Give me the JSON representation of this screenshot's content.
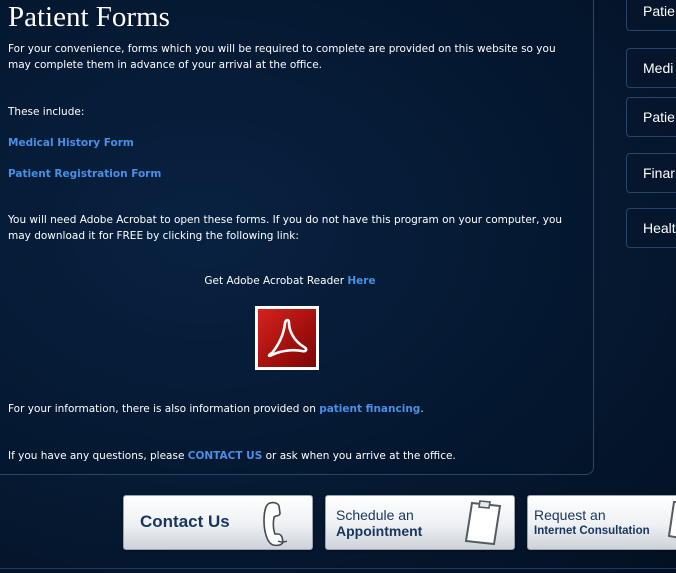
{
  "page": {
    "title": "Patient Forms"
  },
  "content": {
    "intro": "For your convenience, forms which you will be required to complete are provided on this website so you may complete them in advance of your arrival at the office.",
    "includes_label": "These include:",
    "forms": [
      {
        "label": "Medical History Form"
      },
      {
        "label": "Patient Registration Form"
      }
    ],
    "acrobat_note": "You will need Adobe Acrobat to open these forms.  If you do not have this program on your computer, you may download it for FREE by clicking the following link:",
    "acrobat_line": {
      "prefix": "Get Adobe Acrobat Reader ",
      "link": "Here"
    },
    "financing": {
      "prefix": "For your information, there is also information provided on ",
      "link": "patient financing",
      "suffix": "."
    },
    "contact": {
      "prefix": "If you have any questions, please ",
      "link": "CONTACT US",
      "suffix": " or ask when you arrive at the office."
    }
  },
  "sidebar": {
    "items": [
      {
        "label": "Patie"
      },
      {
        "label": "Medi"
      },
      {
        "label": "Patie"
      },
      {
        "label": "Finar"
      },
      {
        "label": "Healt"
      }
    ]
  },
  "cta": {
    "contact": {
      "label": "Contact Us",
      "icon": "phone-icon"
    },
    "schedule": {
      "line1": "Schedule an",
      "line2": "Appointment",
      "icon": "clipboard-icon"
    },
    "request": {
      "line1": "Request an",
      "line2": "Internet Consultation",
      "icon": "clipboard-icon"
    }
  },
  "colors": {
    "link": "#4a8ee6",
    "background": "#061a33",
    "cta_text": "#16365e",
    "pdf_red": "#c41a16"
  }
}
